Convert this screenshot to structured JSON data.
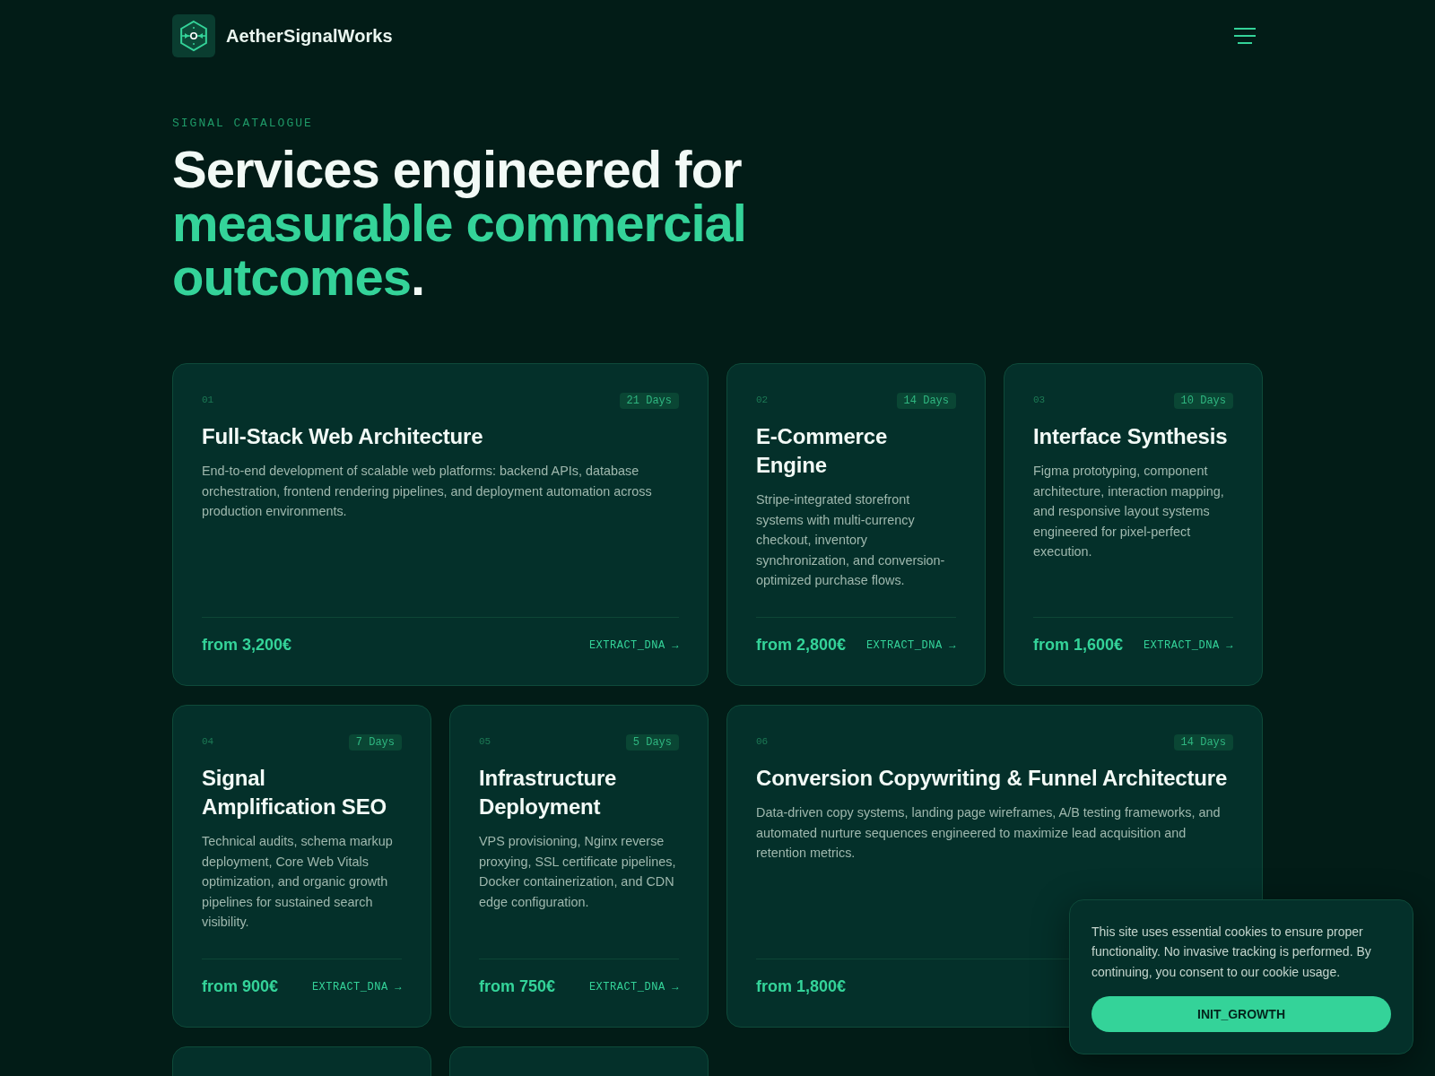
{
  "header": {
    "brand": "AetherSignalWorks"
  },
  "hero": {
    "eyebrow": "SIGNAL CATALOGUE",
    "title": [
      {
        "text": "Services engineered for ",
        "accent": false
      },
      {
        "text": "measurable commercial outcomes",
        "accent": true
      },
      {
        "text": ".",
        "accent": false
      }
    ]
  },
  "cards": [
    {
      "kind": "wide",
      "number": "01",
      "duration": "21 Days",
      "title": "Full-Stack Web Architecture",
      "description": "End-to-end development of scalable web platforms: backend APIs, database orchestration, frontend rendering pipelines, and deployment automation across production environments.",
      "price": "from 3,200€",
      "link": "EXTRACT_DNA →"
    },
    {
      "kind": "standard",
      "number": "02",
      "duration": "14 Days",
      "title": "E-Commerce Engine",
      "description": "Stripe-integrated storefront systems with multi-currency checkout, inventory synchronization, and conversion-optimized purchase flows.",
      "price": "from 2,800€",
      "link": "EXTRACT_DNA →"
    },
    {
      "kind": "standard",
      "number": "03",
      "duration": "10 Days",
      "title": "Interface Synthesis",
      "description": "Figma prototyping, component architecture, interaction mapping, and responsive layout systems engineered for pixel-perfect execution.",
      "price": "from 1,600€",
      "link": "EXTRACT_DNA →"
    },
    {
      "kind": "standard",
      "number": "04",
      "duration": "7 Days",
      "title": "Signal Amplification SEO",
      "description": "Technical audits, schema markup deployment, Core Web Vitals optimization, and organic growth pipelines for sustained search visibility.",
      "price": "from 900€",
      "link": "EXTRACT_DNA →"
    },
    {
      "kind": "standard",
      "number": "05",
      "duration": "5 Days",
      "title": "Infrastructure Deployment",
      "description": "VPS provisioning, Nginx reverse proxying, SSL certificate pipelines, Docker containerization, and CDN edge configuration.",
      "price": "from 750€",
      "link": "EXTRACT_DNA →"
    },
    {
      "kind": "wide",
      "number": "06",
      "duration": "14 Days",
      "title": "Conversion Copywriting & Funnel Architecture",
      "description": "Data-driven copy systems, landing page wireframes, A/B testing frameworks, and automated nurture sequences engineered to maximize lead acquisition and retention metrics.",
      "price": "from 1,800€"
    },
    {
      "kind": "partial"
    },
    {
      "kind": "partial"
    }
  ],
  "cookie_banner": {
    "message": "This site uses essential cookies to ensure proper functionality. No invasive tracking is performed. By continuing, you consent to our cookie usage.",
    "button": "INIT_GROWTH"
  }
}
